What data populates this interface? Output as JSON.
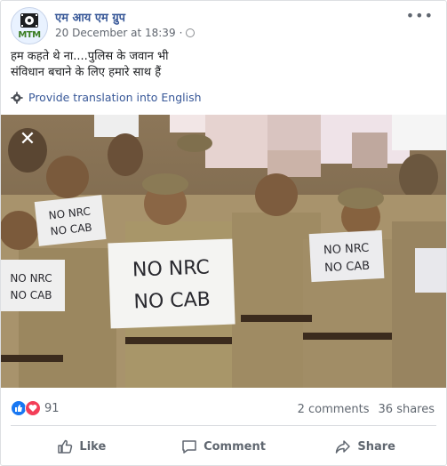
{
  "post": {
    "page_name": "एम आय एम ग्रुप",
    "timestamp": "20 December at 18:39",
    "privacy_icon": "globe-icon",
    "text_line1": "हम कहते थे ना....पुलिस के जवान भी",
    "text_line2": "संविधान बचाने के लिए हमारे साथ हैं",
    "translate_label": "Provide translation into English"
  },
  "avatar": {
    "text": "MTM"
  },
  "photo": {
    "sign_large_line1": "NO NRC",
    "sign_large_line2": "NO CAB",
    "sign_left_line1": "NO NRC",
    "sign_left_line2": "NO CAB",
    "sign_right_line1": "NO NRC",
    "sign_right_line2": "NO CAB",
    "sign_far_left_line1": "NO NRC",
    "sign_far_left_line2": "NO CAB"
  },
  "stats": {
    "reaction_count": "91",
    "comments": "2 comments",
    "shares": "36 shares"
  },
  "actions": {
    "like": "Like",
    "comment": "Comment",
    "share": "Share"
  },
  "colors": {
    "link": "#385898",
    "like_blue": "#1877f2",
    "love_red": "#f33e58"
  }
}
